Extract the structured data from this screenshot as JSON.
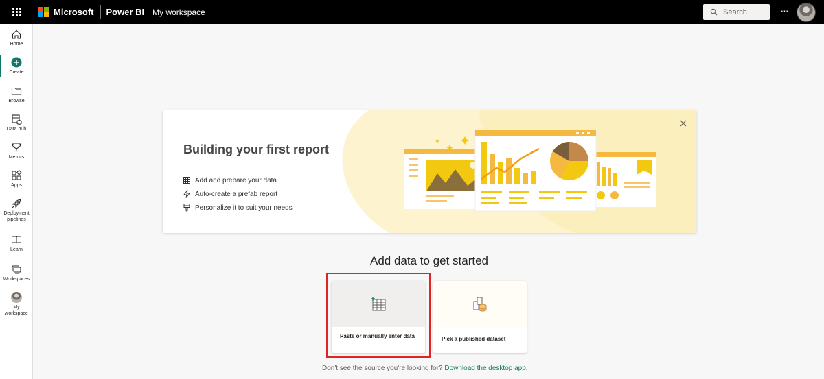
{
  "topbar": {
    "brand": "Microsoft",
    "product": "Power BI",
    "workspace": "My workspace",
    "search_placeholder": "Search",
    "more_label": "···",
    "brand_colors": [
      "#f25022",
      "#7fba00",
      "#00a4ef",
      "#ffb900"
    ]
  },
  "nav": {
    "items": [
      {
        "label": "Home",
        "icon": "home-icon"
      },
      {
        "label": "Create",
        "icon": "create-plus-icon"
      },
      {
        "label": "Browse",
        "icon": "folder-icon"
      },
      {
        "label": "Data hub",
        "icon": "data-hub-icon"
      },
      {
        "label": "Metrics",
        "icon": "trophy-icon"
      },
      {
        "label": "Apps",
        "icon": "apps-icon"
      },
      {
        "label": "Deployment pipelines",
        "icon": "rocket-icon"
      },
      {
        "label": "Learn",
        "icon": "book-icon"
      },
      {
        "label": "Workspaces",
        "icon": "workspaces-icon"
      },
      {
        "label": "My workspace",
        "icon": "avatar-icon"
      }
    ],
    "active_color": "#117865"
  },
  "banner": {
    "title": "Building your first report",
    "items": [
      {
        "text": "Add and prepare your data",
        "icon": "table-icon"
      },
      {
        "text": "Auto-create a prefab report",
        "icon": "lightning-icon"
      },
      {
        "text": "Personalize it to suit your needs",
        "icon": "brush-icon"
      }
    ],
    "accent": "#f2c811"
  },
  "add_data": {
    "title": "Add data to get started",
    "cards": [
      {
        "label": "Paste or manually enter data",
        "icon": "table-plus-icon"
      },
      {
        "label": "Pick a published dataset",
        "icon": "dataset-icon"
      }
    ]
  },
  "footer": {
    "prefix": "Don't see the source you're looking for? ",
    "link": "Download the desktop app",
    "suffix": "."
  }
}
